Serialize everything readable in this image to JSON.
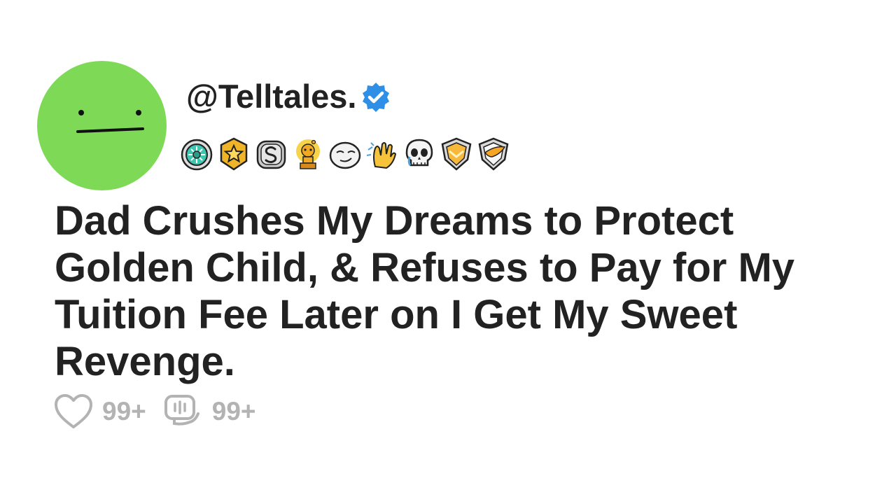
{
  "post": {
    "username": "@Telltales.",
    "verified": true,
    "badges": [
      "teal-gem-medal-icon",
      "gold-star-medal-icon",
      "silver-s-medal-icon",
      "gold-snoo-trophy-icon",
      "smirking-face-icon",
      "clapping-hands-icon",
      "crying-skull-icon",
      "gold-chevron-shield-icon",
      "gold-wing-shield-icon"
    ],
    "title": "Dad Crushes My Dreams to Protect Golden Child, & Refuses to Pay for My Tuition Fee Later on I Get My Sweet Revenge.",
    "likes": "99+",
    "comments": "99+"
  },
  "colors": {
    "avatar": "#7ed957",
    "verified": "#2f8fe6",
    "text": "#222222",
    "stats": "#b3b3b3"
  }
}
